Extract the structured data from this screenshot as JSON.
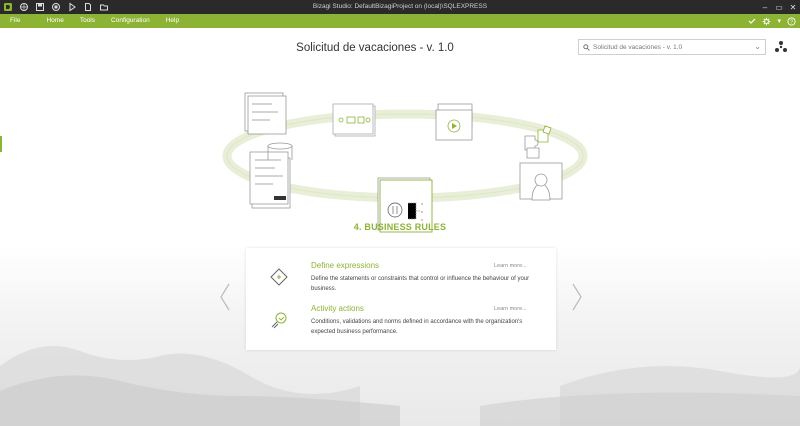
{
  "window": {
    "title": "Bizagi Studio: DefaultBizagiProject  on (local)\\SQLEXPRESS",
    "controls": [
      "minimize",
      "maximize",
      "close"
    ]
  },
  "quick_access_icons": [
    "bizagi-logo-icon",
    "globe-icon",
    "save-icon",
    "stop-icon",
    "run-icon",
    "document-icon",
    "folder-icon"
  ],
  "menu": {
    "items": [
      "File",
      "Home",
      "Tools",
      "Configuration",
      "Help"
    ],
    "right_icons": [
      "checkmark-icon",
      "settings-icon",
      "help-icon"
    ]
  },
  "page": {
    "title": "Solicitud de vacaciones - v. 1.0",
    "search": {
      "value": "Solicitud de vacaciones - v. 1.0"
    },
    "stage_title": "4. BUSINESS RULES"
  },
  "rules": [
    {
      "title": "Define expressions",
      "learn_more": "Learn more...",
      "description": "Define the statements or constraints that control or influence the behaviour of your business.",
      "icon": "expression-diamond-icon"
    },
    {
      "title": "Activity actions",
      "learn_more": "Learn more...",
      "description": "Conditions, validations and norms defined in accordance with the organization's expected business performance.",
      "icon": "activity-actions-icon"
    }
  ],
  "colors": {
    "accent": "#8cb334",
    "titlebar": "#2a2a2a"
  }
}
